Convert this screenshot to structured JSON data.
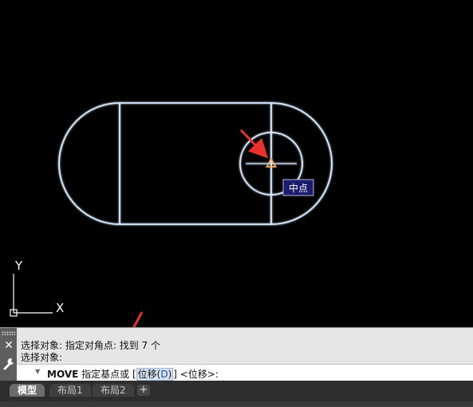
{
  "drawing": {
    "snap_tooltip": "中点",
    "ucs_x_label": "X",
    "ucs_y_label": "Y",
    "colors": {
      "geometry": "#d9ecff",
      "geometry_glow": "#4d8dff",
      "snap_marker": "#ffb060",
      "annotation_arrow": "#e8322b",
      "tooltip_bg": "#1c1c6e"
    }
  },
  "command_line": {
    "history": [
      "选择对象: 指定对角点: 找到 7 个",
      "选择对象:"
    ],
    "command": "MOVE",
    "prompt_before": " 指定基点或 [",
    "option_label": "位移",
    "option_open": "(",
    "option_key": "D",
    "option_close": ")",
    "prompt_after": "] <位移>:"
  },
  "tabs": [
    {
      "label": "模型",
      "active": true
    },
    {
      "label": "布局1",
      "active": false
    },
    {
      "label": "布局2",
      "active": false
    }
  ],
  "tab_add_label": "+"
}
